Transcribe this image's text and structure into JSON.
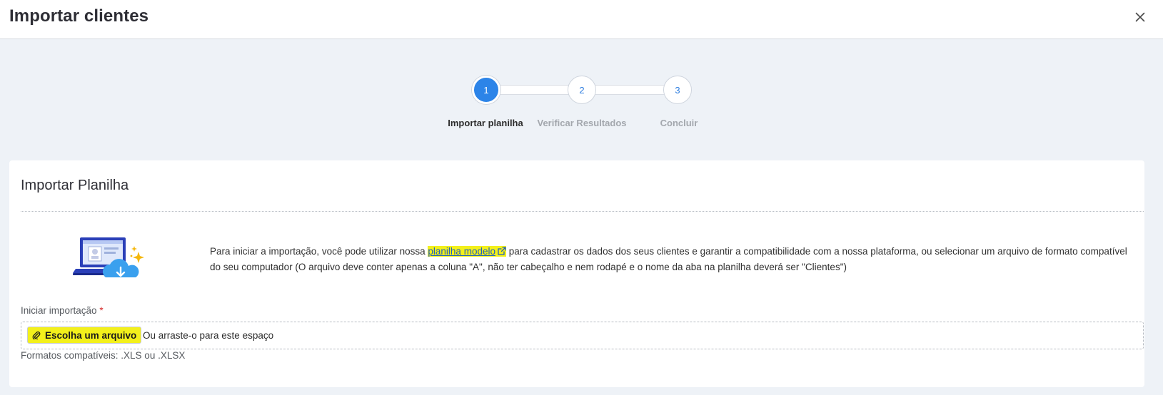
{
  "header": {
    "title": "Importar clientes"
  },
  "stepper": {
    "steps": [
      {
        "number": "1",
        "label": "Importar planilha"
      },
      {
        "number": "2",
        "label": "Verificar Resultados"
      },
      {
        "number": "3",
        "label": "Concluir"
      }
    ]
  },
  "card": {
    "title": "Importar Planilha",
    "description_before": "Para iniciar a importação, você pode utilizar nossa ",
    "template_link": "planilha modelo",
    "description_after": " para cadastrar os dados dos seus clientes e garantir a compatibilidade com a nossa plataforma, ou selecionar um arquivo de formato compatível do seu computador (O arquivo deve conter apenas a coluna \"A\", não ter cabeçalho e nem rodapé e o nome da aba na planilha deverá ser \"Clientes\")",
    "field_label": "Iniciar importação",
    "required_mark": "*",
    "choose_button": "Escolha um arquivo",
    "drop_text": "Ou arraste-o para este espaço",
    "formats": "Formatos compatíveis: .XLS ou .XLSX"
  },
  "colors": {
    "accent": "#2c84e8",
    "highlight": "#f3f01b",
    "required": "#d62d2d"
  },
  "icons": {
    "close": "close-icon",
    "external_link": "external-link-icon",
    "attach": "paperclip-icon",
    "illustration": "laptop-cloud-download-illustration"
  }
}
